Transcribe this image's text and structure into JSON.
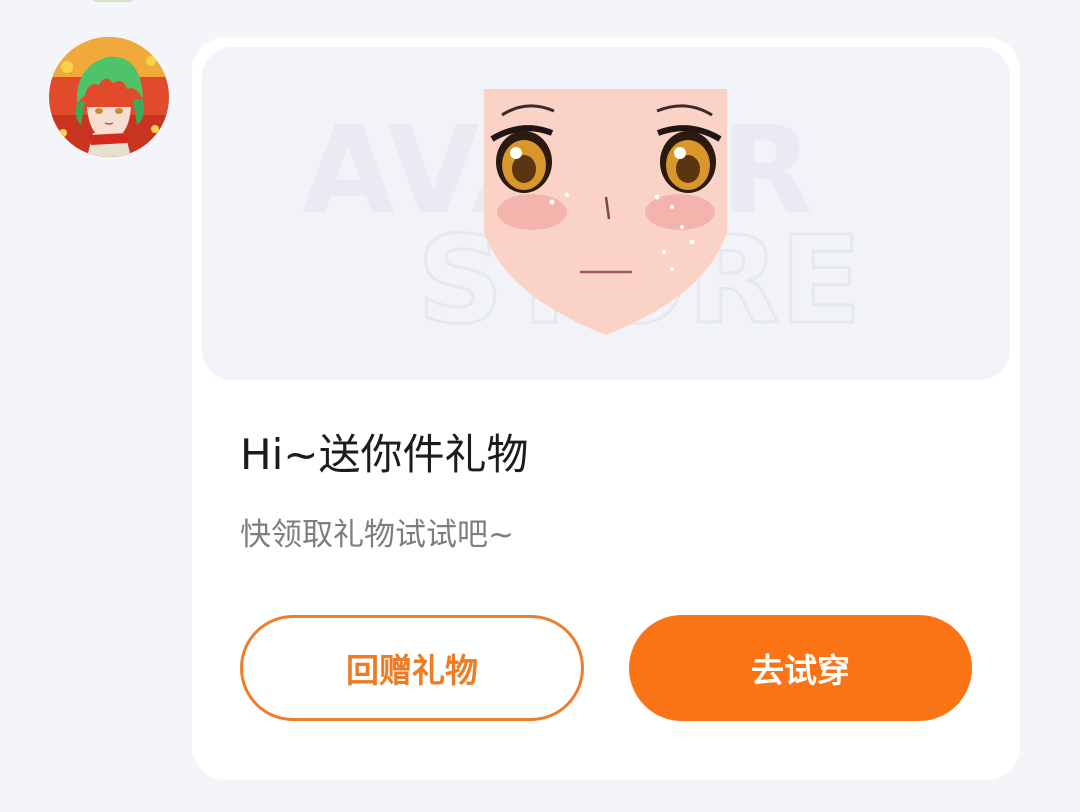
{
  "sender": {
    "avatar_icon": "anime-boy-avatar"
  },
  "gift_card": {
    "preview_icon": "anime-face-preview",
    "watermark_line1": "AVATAR",
    "watermark_line2": "STORE",
    "title": "Hi~送你件礼物",
    "subtitle": "快领取礼物试试吧~",
    "return_gift_label": "回赠礼物",
    "try_on_label": "去试穿"
  },
  "colors": {
    "page_bg": "#f3f5f9",
    "card_bg": "#ffffff",
    "hero_bg": "#f2f3f9",
    "accent": "#fa7314",
    "accent_text": "#ef7b22",
    "title_text": "#1c1c1c",
    "subtitle_text": "#7e7e7e"
  }
}
